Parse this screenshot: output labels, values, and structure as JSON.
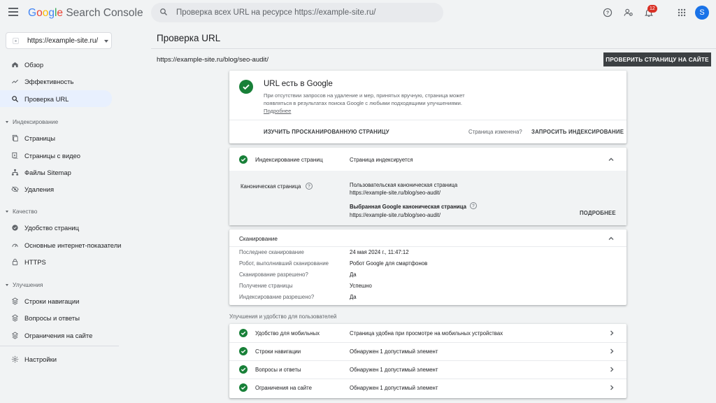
{
  "header": {
    "logo_google": "Google",
    "logo_product": "Search Console",
    "search_placeholder": "Проверка всех URL на ресурсе https://example-site.ru/",
    "notifications_count": "12",
    "avatar_letter": "S"
  },
  "sidebar": {
    "property": "https://example-site.ru/",
    "items_top": [
      {
        "label": "Обзор",
        "icon": "home-icon"
      },
      {
        "label": "Эффективность",
        "icon": "trending-up-icon"
      },
      {
        "label": "Проверка URL",
        "icon": "search-icon",
        "active": true
      }
    ],
    "section_indexing": "Индексирование",
    "items_indexing": [
      {
        "label": "Страницы",
        "icon": "pages-icon"
      },
      {
        "label": "Страницы с видео",
        "icon": "video-pages-icon"
      },
      {
        "label": "Файлы Sitemap",
        "icon": "sitemap-icon"
      },
      {
        "label": "Удаления",
        "icon": "removals-icon"
      }
    ],
    "section_quality": "Качество",
    "items_quality": [
      {
        "label": "Удобство страниц",
        "icon": "page-experience-icon"
      },
      {
        "label": "Основные интернет-показатели",
        "icon": "core-web-vitals-icon"
      },
      {
        "label": "HTTPS",
        "icon": "lock-icon"
      }
    ],
    "section_enhancements": "Улучшения",
    "items_enhancements": [
      {
        "label": "Строки навигации",
        "icon": "breadcrumbs-icon"
      },
      {
        "label": "Вопросы и ответы",
        "icon": "faq-icon"
      },
      {
        "label": "Ограничения на сайте",
        "icon": "sitelinks-icon"
      }
    ],
    "settings": {
      "label": "Настройки",
      "icon": "gear-icon"
    }
  },
  "main": {
    "page_title": "Проверка URL",
    "inspected_url": "https://example-site.ru/blog/seo-audit/",
    "test_live_button": "ПРОВЕРИТЬ СТРАНИЦУ НА САЙТЕ",
    "status_card": {
      "title": "URL есть в Google",
      "description": "При отсутствии запросов на удаление и мер, принятых вручную, страница может появляться в результатах поиска Google с любыми подходящими улучшениями.",
      "learn_more": "Подробнее",
      "view_crawled": "ИЗУЧИТЬ ПРОСКАНИРОВАННУЮ СТРАНИЦУ",
      "page_changed": "Страница изменена?",
      "request_indexing": "ЗАПРОСИТЬ ИНДЕКСИРОВАНИЕ"
    },
    "indexing_card": {
      "label": "Индексирование страниц",
      "status": "Страница индексируется",
      "canonical_label": "Каноническая страница",
      "user_canonical_label": "Пользовательская каноническая страница",
      "user_canonical_url": "https://example-site.ru/blog/seo-audit/",
      "google_canonical_label": "Выбранная Google каноническая страница",
      "google_canonical_url": "https://example-site.ru/blog/seo-audit/",
      "details": "ПОДРОБНЕЕ"
    },
    "crawl_card": {
      "title": "Сканирование",
      "rows": [
        {
          "label": "Последнее сканирование",
          "value": "24 мая 2024 г., 11:47:12"
        },
        {
          "label": "Робот, выполнивший сканирование",
          "value": "Робот Google для смартфонов"
        },
        {
          "label": "Сканирование разрешено?",
          "value": "Да"
        },
        {
          "label": "Получение страницы",
          "value": "Успешно"
        },
        {
          "label": "Индексирование разрешено?",
          "value": "Да"
        }
      ]
    },
    "enhancements_label": "Улучшения и удобство для пользователей",
    "enhancements": [
      {
        "label": "Удобство для мобильных",
        "value": "Страница удобна при просмотре на мобильных устройствах"
      },
      {
        "label": "Строки навигации",
        "value": "Обнаружен 1 допустимый элемент"
      },
      {
        "label": "Вопросы и ответы",
        "value": "Обнаружен 1 допустимый элемент"
      },
      {
        "label": "Ограничения на сайте",
        "value": "Обнаружен 1 допустимый элемент"
      }
    ]
  },
  "colors": {
    "accent": "#1a73e8",
    "success": "#188038",
    "active_nav": "#e8f0fe",
    "badge": "#d93025"
  }
}
